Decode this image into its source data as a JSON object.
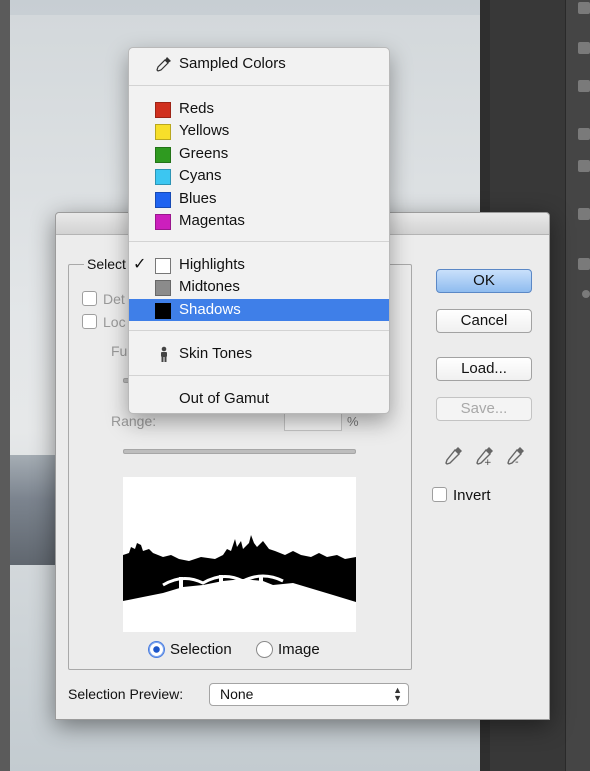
{
  "dialog": {
    "group_label": "Select",
    "detect_faces_label": "Det",
    "localized_label": "Loc",
    "fuzziness_label": "Fu",
    "range_label": "Range:",
    "range_unit": "%",
    "radio_selection": "Selection",
    "radio_image": "Image",
    "selected_radio": "Selection",
    "selection_preview_label": "Selection Preview:",
    "selection_preview_value": "None",
    "invert_label": "Invert"
  },
  "buttons": {
    "ok": "OK",
    "cancel": "Cancel",
    "load": "Load...",
    "save": "Save..."
  },
  "menu": {
    "sampled": "Sampled Colors",
    "colors": [
      {
        "label": "Reds",
        "color": "#d0301e"
      },
      {
        "label": "Yellows",
        "color": "#f7df2a"
      },
      {
        "label": "Greens",
        "color": "#2f9a20"
      },
      {
        "label": "Cyans",
        "color": "#3cc6f1"
      },
      {
        "label": "Blues",
        "color": "#1f63f0"
      },
      {
        "label": "Magentas",
        "color": "#cc1fbd"
      }
    ],
    "tones": [
      {
        "label": "Highlights",
        "color": "#ffffff",
        "checked": true
      },
      {
        "label": "Midtones",
        "color": "#8b8b8b",
        "checked": false
      },
      {
        "label": "Shadows",
        "color": "#000000",
        "checked": false,
        "selected": true
      }
    ],
    "skin_tones": "Skin Tones",
    "out_of_gamut": "Out of Gamut",
    "check_mark": "✓"
  },
  "colors": {
    "accent": "#3f7fe8",
    "primary_button": "#8fbcef"
  }
}
